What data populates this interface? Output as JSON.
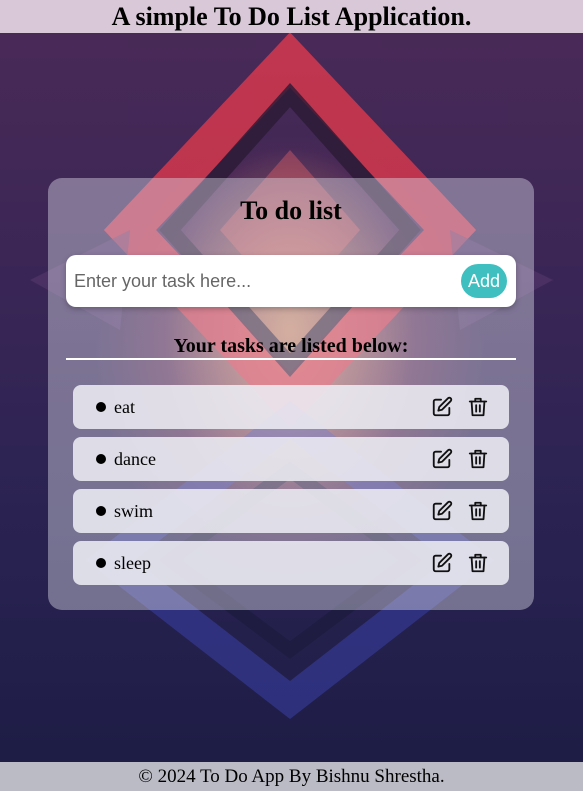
{
  "header": {
    "title": "A simple To Do List Application."
  },
  "card": {
    "title": "To do list",
    "input": {
      "placeholder": "Enter your task here...",
      "value": ""
    },
    "add_label": "Add",
    "list_heading": "Your tasks are listed below:",
    "tasks": [
      {
        "text": "eat"
      },
      {
        "text": "dance"
      },
      {
        "text": "swim"
      },
      {
        "text": "sleep"
      }
    ],
    "icons": {
      "edit": "edit-icon",
      "delete": "trash-icon"
    }
  },
  "footer": {
    "text": "© 2024 To Do App By Bishnu Shrestha."
  },
  "colors": {
    "accent": "#3fbfbf",
    "header_bg": "#d9c8d8",
    "footer_bg": "#babbc4"
  }
}
